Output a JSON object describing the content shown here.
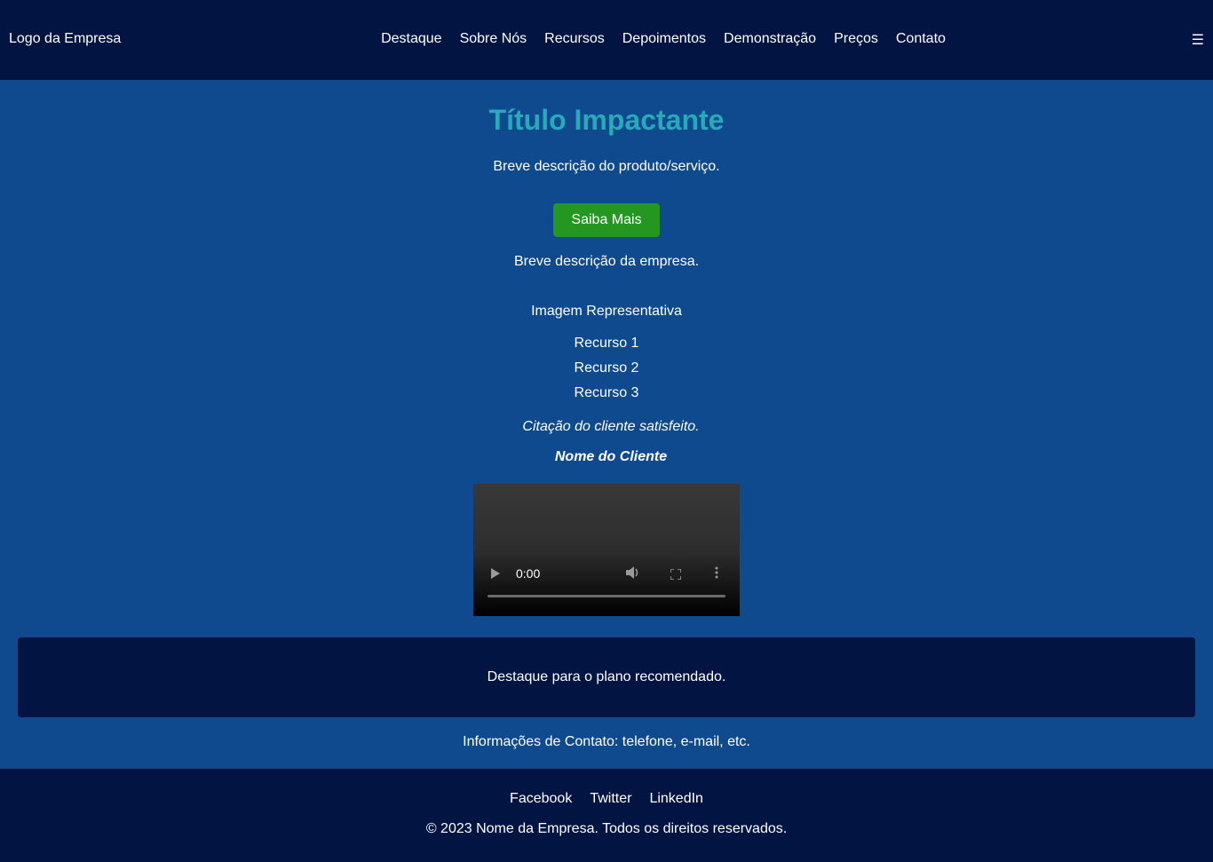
{
  "header": {
    "logo_alt": "Logo da Empresa",
    "nav": [
      "Destaque",
      "Sobre Nós",
      "Recursos",
      "Depoimentos",
      "Demonstração",
      "Preços",
      "Contato"
    ],
    "menu_icon": "☰"
  },
  "hero": {
    "title": "Título Impactante",
    "description": "Breve descrição do produto/serviço.",
    "button_label": "Saiba Mais"
  },
  "about": {
    "description": "Breve descrição da empresa.",
    "image_alt": "Imagem Representativa"
  },
  "features": [
    "Recurso 1",
    "Recurso 2",
    "Recurso 3"
  ],
  "testimonial": {
    "quote": "Citação do cliente satisfeito.",
    "client": "Nome do Cliente"
  },
  "video": {
    "time": "0:00",
    "play_icon": "play-icon",
    "volume_icon": "volume-icon",
    "fullscreen_icon": "fullscreen-icon",
    "more_icon": "more-vertical-icon"
  },
  "pricing": {
    "highlight": "Destaque para o plano recomendado."
  },
  "contact": {
    "info": "Informações de Contato: telefone, e-mail, etc."
  },
  "footer": {
    "social": [
      "Facebook",
      "Twitter",
      "LinkedIn"
    ],
    "copyright": "© 2023 Nome da Empresa. Todos os direitos reservados."
  },
  "colors": {
    "header_bg": "#011442",
    "page_bg": "#0e4a8d",
    "title": "#27aab9",
    "button": "#239720"
  }
}
